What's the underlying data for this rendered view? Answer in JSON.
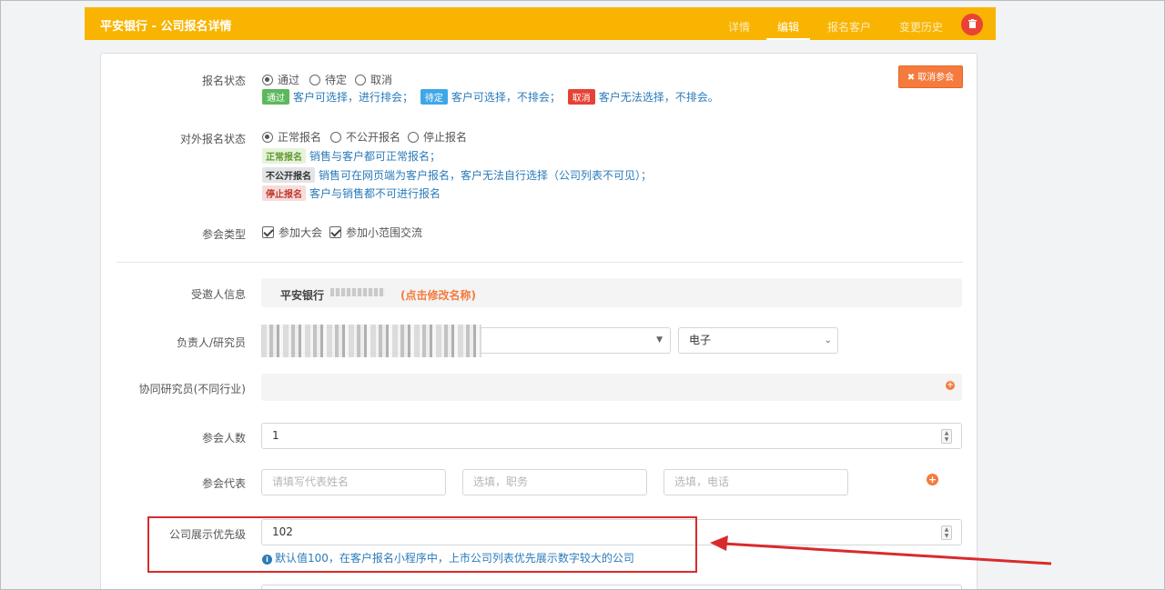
{
  "header": {
    "title": "平安银行 - 公司报名详情",
    "tabs": [
      {
        "label": "详情"
      },
      {
        "label": "编辑"
      },
      {
        "label": "报名客户"
      },
      {
        "label": "变更历史"
      }
    ],
    "active_tab": "编辑"
  },
  "cancel_button": {
    "label": "取消参会"
  },
  "signup_status": {
    "label": "报名状态",
    "options": [
      "通过",
      "待定",
      "取消"
    ],
    "selected": "通过",
    "legend": [
      {
        "badge": "通过",
        "text": "客户可选择，进行排会；",
        "color": "#5cb85c"
      },
      {
        "badge": "待定",
        "text": "客户可选择，不排会；",
        "color": "#3ea7e8"
      },
      {
        "badge": "取消",
        "text": "客户无法选择，不排会。",
        "color": "#e54235"
      }
    ]
  },
  "external_status": {
    "label": "对外报名状态",
    "options": [
      "正常报名",
      "不公开报名",
      "停止报名"
    ],
    "selected": "正常报名",
    "legend": [
      {
        "tag": "正常报名",
        "text": "销售与客户都可正常报名；",
        "color": "#5f9a2e",
        "bg": "#e6f2da"
      },
      {
        "tag": "不公开报名",
        "text": "销售可在网页端为客户报名，客户无法自行选择（公司列表不可见）；",
        "color": "#333333",
        "bg": "#e3e4e6"
      },
      {
        "tag": "停止报名",
        "text": "客户与销售都不可进行报名",
        "color": "#c0392b",
        "bg": "#f7dcdc"
      }
    ]
  },
  "meeting_type": {
    "label": "参会类型",
    "options": [
      "参加大会",
      "参加小范围交流"
    ]
  },
  "invitee": {
    "label": "受邀人信息",
    "name": "平安银行",
    "edit_link": "(点击修改名称)"
  },
  "owner": {
    "label": "负责人/研究员",
    "industry": "电子"
  },
  "co_researcher": {
    "label": "协同研究员(不同行业)"
  },
  "attendee_count": {
    "label": "参会人数",
    "value": "1"
  },
  "representative": {
    "label": "参会代表",
    "placeholders": [
      "请填写代表姓名",
      "选填，职务",
      "选填，电话"
    ]
  },
  "priority": {
    "label": "公司展示优先级",
    "value": "102",
    "hint": "默认值100，在客户报名小程序中，上市公司列表优先展示数字较大的公司"
  },
  "colors": {
    "header": "#f8b400",
    "accent": "#f47b3d",
    "annotation": "#d92b2b"
  }
}
